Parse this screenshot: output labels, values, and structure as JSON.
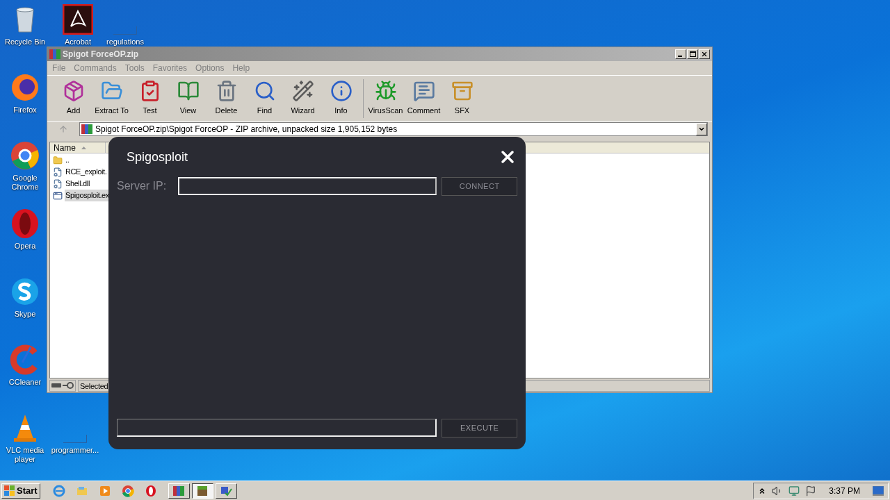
{
  "desktop": {
    "icons": [
      {
        "label": "Recycle Bin",
        "kind": "recycle"
      },
      {
        "label": "Acrobat",
        "kind": "acrobat"
      },
      {
        "label": "regulations",
        "kind": "blank"
      },
      {
        "label": "Firefox",
        "kind": "firefox"
      },
      {
        "label": "Google Chrome",
        "kind": "chrome"
      },
      {
        "label": "Opera",
        "kind": "opera"
      },
      {
        "label": "Skype",
        "kind": "skype"
      },
      {
        "label": "CCleaner",
        "kind": "ccleaner"
      },
      {
        "label": "VLC media player",
        "kind": "vlc"
      },
      {
        "label": "programmer...",
        "kind": "blank"
      }
    ]
  },
  "winrar": {
    "title": "Spigot ForceOP.zip",
    "menu": [
      "File",
      "Commands",
      "Tools",
      "Favorites",
      "Options",
      "Help"
    ],
    "toolbar_groups": [
      [
        {
          "label": "Add",
          "kind": "add"
        },
        {
          "label": "Extract To",
          "kind": "extract"
        },
        {
          "label": "Test",
          "kind": "test"
        },
        {
          "label": "View",
          "kind": "view"
        },
        {
          "label": "Delete",
          "kind": "delete"
        },
        {
          "label": "Find",
          "kind": "find"
        },
        {
          "label": "Wizard",
          "kind": "wizard"
        },
        {
          "label": "Info",
          "kind": "info"
        }
      ],
      [
        {
          "label": "VirusScan",
          "kind": "virus"
        },
        {
          "label": "Comment",
          "kind": "comment"
        },
        {
          "label": "SFX",
          "kind": "sfx"
        }
      ]
    ],
    "path": "Spigot ForceOP.zip\\Spigot ForceOP - ZIP archive, unpacked size 1,905,152 bytes",
    "columns": [
      "Name"
    ],
    "files": [
      {
        "name": "..",
        "kind": "folder",
        "selected": false
      },
      {
        "name": "RCE_exploit.",
        "kind": "file",
        "selected": false
      },
      {
        "name": "Shell.dll",
        "kind": "file",
        "selected": false
      },
      {
        "name": "Spigosploit.ex",
        "kind": "exe",
        "selected": true
      }
    ],
    "status": "Selected"
  },
  "dialog": {
    "title": "Spigosploit",
    "server_label": "Server IP:",
    "connect": "CONNECT",
    "execute": "EXECUTE"
  },
  "taskbar": {
    "start": "Start",
    "quick_launch": [
      {
        "kind": "ie"
      },
      {
        "kind": "explorer"
      },
      {
        "kind": "media"
      },
      {
        "kind": "chrome"
      },
      {
        "kind": "opera"
      }
    ],
    "running": [
      {
        "kind": "winrar",
        "selected": false
      },
      {
        "kind": "minecraft",
        "selected": true
      },
      {
        "kind": "setup",
        "selected": false
      }
    ],
    "clock": "3:37 PM"
  }
}
